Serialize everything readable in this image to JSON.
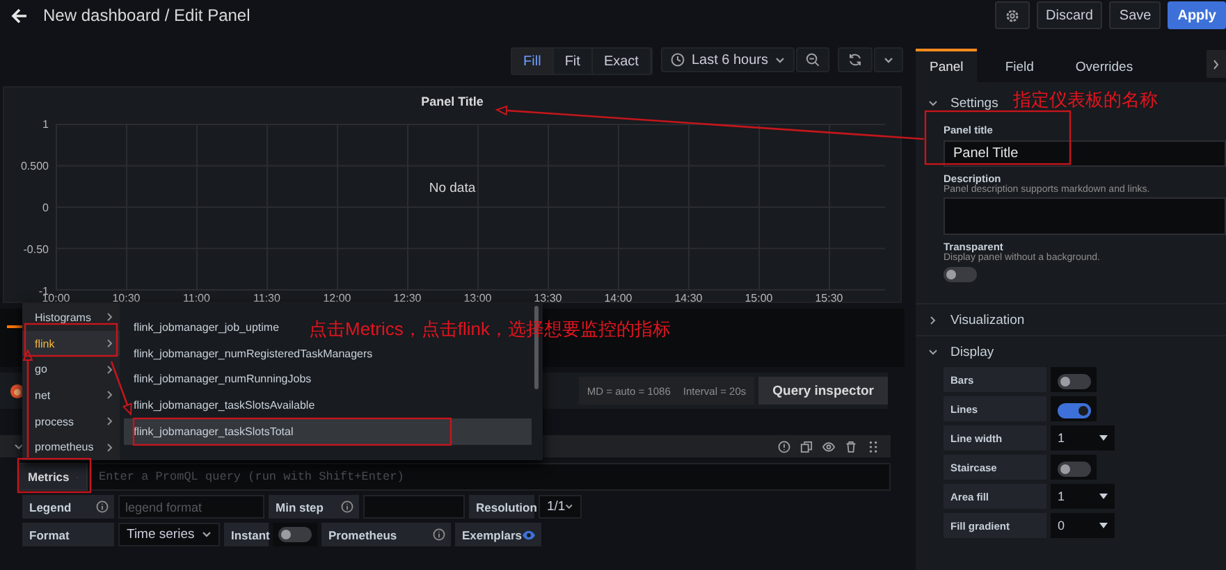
{
  "header": {
    "title": "New dashboard / Edit Panel",
    "actions": [
      {
        "label": "Discard",
        "kind": "secondary"
      },
      {
        "label": "Save",
        "kind": "secondary"
      },
      {
        "label": "Apply",
        "kind": "primary"
      }
    ]
  },
  "toolbar": {
    "view_modes": [
      {
        "label": "Fill",
        "selected": true
      },
      {
        "label": "Fit",
        "selected": false
      },
      {
        "label": "Exact",
        "selected": false
      }
    ],
    "time_range": "Last 6 hours"
  },
  "panel": {
    "title": "Panel Title",
    "message": "No data",
    "y_ticks": [
      "1",
      "0.500",
      "0",
      "-0.50",
      "-1"
    ],
    "x_ticks": [
      "10:00",
      "10:30",
      "11:00",
      "11:30",
      "12:00",
      "12:30",
      "13:00",
      "13:30",
      "14:00",
      "14:30",
      "15:00",
      "15:30"
    ]
  },
  "query": {
    "stats": [
      "MD = auto = 1086",
      "Interval = 20s"
    ],
    "inspector": "Query inspector",
    "metrics_button": "Metrics",
    "placeholder": "Enter a PromQL query (run with Shift+Enter)",
    "rows": [
      {
        "items": [
          {
            "kind": "label",
            "text": "Legend",
            "info": true
          },
          {
            "kind": "input",
            "placeholder": "legend format"
          },
          {
            "kind": "label",
            "text": "Min step",
            "info": true
          },
          {
            "kind": "input"
          },
          {
            "kind": "label",
            "text": "Resolution"
          },
          {
            "kind": "select",
            "value": "1/1"
          }
        ]
      },
      {
        "items": [
          {
            "kind": "label",
            "text": "Format"
          },
          {
            "kind": "select",
            "value": "Time series"
          },
          {
            "kind": "label",
            "text": "Instant"
          },
          {
            "kind": "switch",
            "on": false
          },
          {
            "kind": "label",
            "text": "Prometheus",
            "info": true
          },
          {
            "kind": "eye",
            "text": "Exemplars",
            "on": true
          }
        ]
      }
    ]
  },
  "metrics_menu": {
    "categories": [
      {
        "label": "Histograms",
        "selected": false
      },
      {
        "label": "flink",
        "selected": true
      },
      {
        "label": "go",
        "selected": false
      },
      {
        "label": "net",
        "selected": false
      },
      {
        "label": "process",
        "selected": false
      },
      {
        "label": "prometheus",
        "selected": false
      }
    ],
    "items": [
      {
        "label": "flink_jobmanager_job_uptime",
        "selected": false
      },
      {
        "label": "flink_jobmanager_numRegisteredTaskManagers",
        "selected": false
      },
      {
        "label": "flink_jobmanager_numRunningJobs",
        "selected": false
      },
      {
        "label": "flink_jobmanager_taskSlotsAvailable",
        "selected": false
      },
      {
        "label": "flink_jobmanager_taskSlotsTotal",
        "selected": true
      }
    ]
  },
  "options": {
    "tabs": [
      {
        "label": "Panel",
        "selected": true
      },
      {
        "label": "Field",
        "selected": false
      },
      {
        "label": "Overrides",
        "selected": false
      }
    ],
    "sections": [
      {
        "title": "Settings",
        "expanded": true,
        "fields": [
          {
            "kind": "text",
            "label": "Panel title",
            "value": "Panel Title"
          },
          {
            "kind": "textarea",
            "label": "Description",
            "help": "Panel description supports markdown and links."
          },
          {
            "kind": "switch",
            "label": "Transparent",
            "help": "Display panel without a background.",
            "on": false
          }
        ]
      },
      {
        "title": "Visualization",
        "expanded": false
      },
      {
        "title": "Display",
        "expanded": true,
        "rows": [
          {
            "kind": "switch",
            "label": "Bars",
            "on": false
          },
          {
            "kind": "switch",
            "label": "Lines",
            "on": true
          },
          {
            "kind": "select",
            "label": "Line width",
            "value": "1"
          },
          {
            "kind": "switch",
            "label": "Staircase",
            "on": false
          },
          {
            "kind": "select",
            "label": "Area fill",
            "value": "1"
          },
          {
            "kind": "select",
            "label": "Fill gradient",
            "value": "0"
          }
        ]
      }
    ]
  },
  "annotations": [
    {
      "text": "指定仪表板的名称"
    },
    {
      "text": "点击Metrics，点击flink，选择想要监控的指标"
    }
  ]
}
